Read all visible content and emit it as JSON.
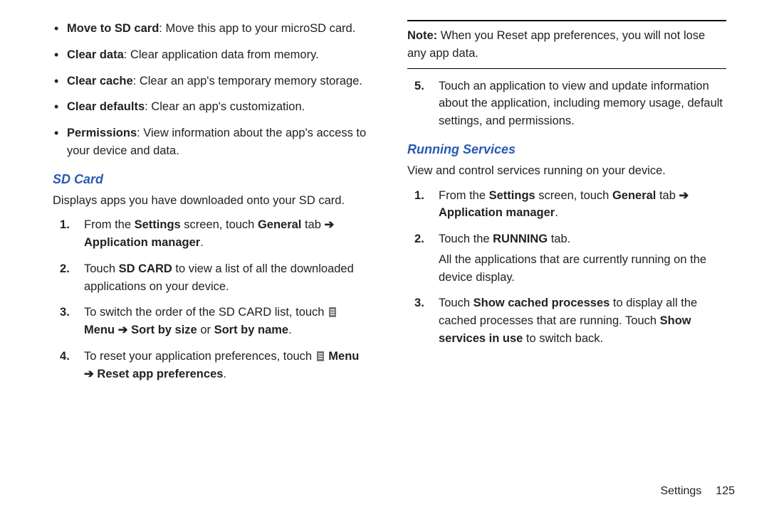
{
  "left": {
    "bullets": [
      {
        "bold": "Move to SD card",
        "rest": ": Move this app to your microSD card."
      },
      {
        "bold": "Clear data",
        "rest": ": Clear application data from memory."
      },
      {
        "bold": "Clear cache",
        "rest": ": Clear an app's temporary memory storage."
      },
      {
        "bold": "Clear defaults",
        "rest": ": Clear an app's customization."
      },
      {
        "bold": "Permissions",
        "rest": ": View information about the app's access to your device and data."
      }
    ],
    "heading": "SD Card",
    "intro": "Displays apps you have downloaded onto your SD card.",
    "step1_a": "From the ",
    "step1_b": "Settings",
    "step1_c": " screen, touch ",
    "step1_d": "General",
    "step1_e": " tab ",
    "step1_arrow": "➔",
    "step1_f": "Application manager",
    "step1_g": ".",
    "step2_a": "Touch ",
    "step2_b": "SD CARD",
    "step2_c": " to view a list of all the downloaded applications on your device.",
    "step3_a": "To switch the order of the SD CARD list, touch ",
    "step3_menu": "Menu",
    "step3_arrow": "➔",
    "step3_b": "Sort by size",
    "step3_or": " or ",
    "step3_c": "Sort by name",
    "step3_d": ".",
    "step4_a": "To reset your application preferences, touch ",
    "step4_menu": "Menu",
    "step4_arrow": "➔",
    "step4_b": "Reset app preferences",
    "step4_c": "."
  },
  "right": {
    "note_bold": "Note:",
    "note_text": " When you Reset app preferences, you will not lose any app data.",
    "step5": "Touch an application to view and update information about the application, including memory usage, default settings, and permissions.",
    "heading": "Running Services",
    "intro": "View and control services running on your device.",
    "r1_a": "From the ",
    "r1_b": "Settings",
    "r1_c": " screen, touch ",
    "r1_d": "General",
    "r1_e": " tab ",
    "r1_arrow": "➔",
    "r1_f": "Application manager",
    "r1_g": ".",
    "r2_a": "Touch the ",
    "r2_b": "RUNNING",
    "r2_c": " tab.",
    "r2_sub": "All the applications that are currently running on the device display.",
    "r3_a": "Touch ",
    "r3_b": "Show cached processes",
    "r3_c": " to display all the cached processes that are running. Touch ",
    "r3_d": "Show services in use",
    "r3_e": " to switch back."
  },
  "footer": {
    "section": "Settings",
    "page": "125"
  }
}
